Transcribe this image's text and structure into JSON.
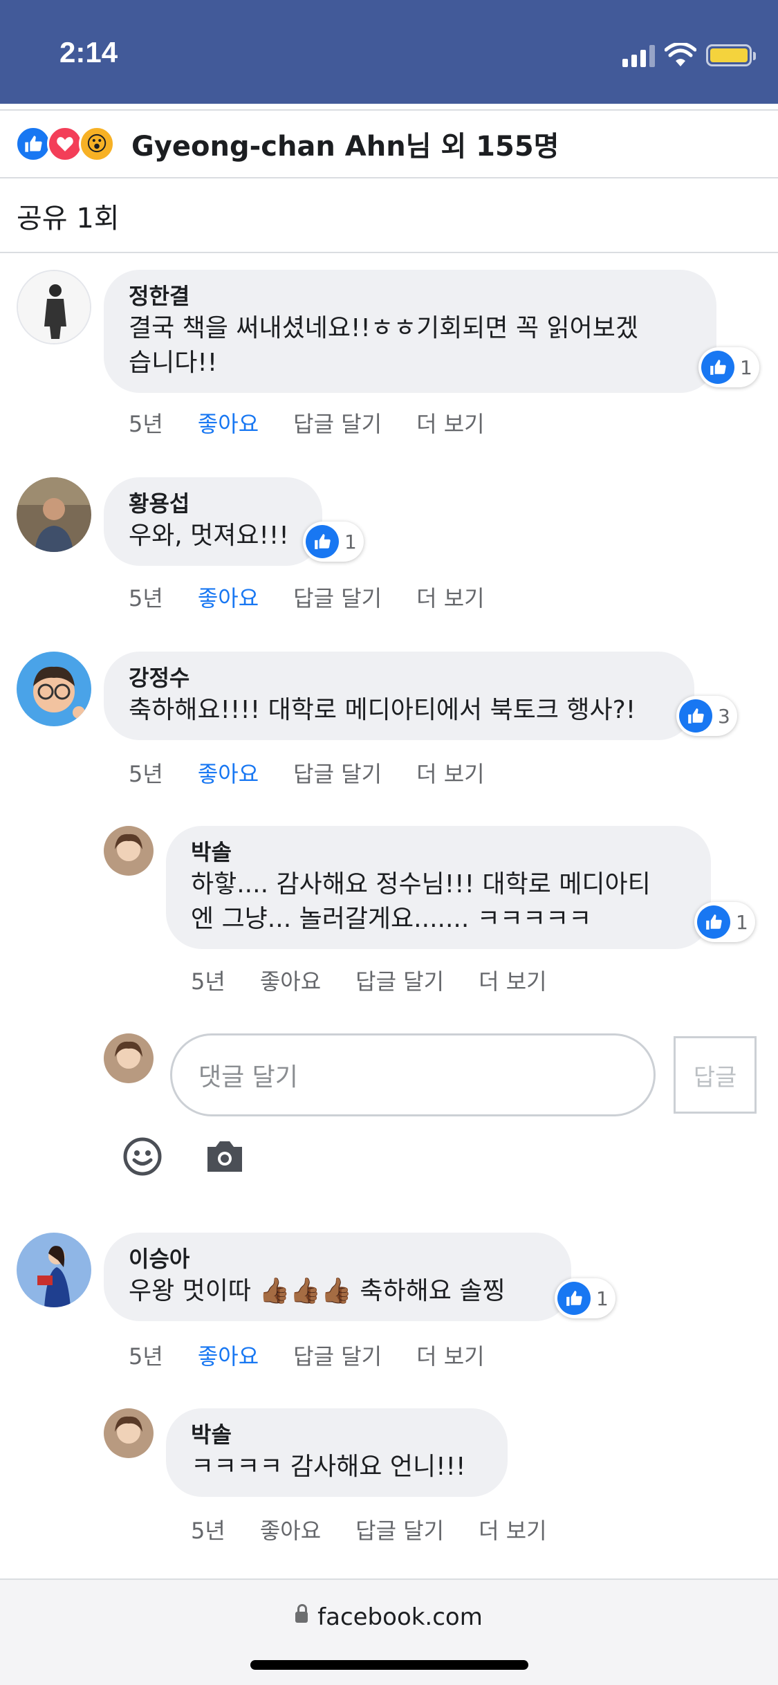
{
  "status_bar": {
    "time": "2:14"
  },
  "reactions": {
    "icons": [
      "like-icon",
      "love-icon",
      "wow-icon"
    ],
    "text": "Gyeong-chan Ahn님 외 155명"
  },
  "share": {
    "text": "공유 1회"
  },
  "action_labels": {
    "like": "좋아요",
    "reply": "답글 달기",
    "more": "더 보기"
  },
  "comments": [
    {
      "author": "정한결",
      "lines": [
        "결국 책을 써내셨네요!!ㅎㅎ기회되면 꼭 읽어보겠",
        "습니다!!"
      ],
      "reaction_count": "1",
      "time": "5년",
      "liked": true
    },
    {
      "author": "황용섭",
      "lines": [
        "우와, 멋져요!!!"
      ],
      "reaction_count": "1",
      "time": "5년",
      "liked": true
    },
    {
      "author": "강정수",
      "lines": [
        "축하해요!!!! 대학로 메디아티에서 북토크 행사?!"
      ],
      "reaction_count": "3",
      "time": "5년",
      "liked": true
    },
    {
      "author": "박솔",
      "lines": [
        "하핳.... 감사해요 정수님!!! 대학로 메디아티",
        "엔 그냥... 놀러갈게요....... ㅋㅋㅋㅋㅋ"
      ],
      "reaction_count": "1",
      "time": "5년",
      "liked": false
    },
    {
      "author": "이승아",
      "lines": [
        "우왕 멋이따 👍🏾👍🏾👍🏾 축하해요 솔찡"
      ],
      "reaction_count": "1",
      "time": "5년",
      "liked": true
    },
    {
      "author": "박솔",
      "lines": [
        "ㅋㅋㅋㅋ 감사해요 언니!!!"
      ],
      "reaction_count": "",
      "time": "5년",
      "liked": false
    }
  ],
  "reply_box": {
    "placeholder": "댓글 달기",
    "button": "답글"
  },
  "browser": {
    "url": "facebook.com"
  },
  "colors": {
    "header_bg": "#425a99",
    "like_blue": "#1877f2",
    "bubble_bg": "#eff0f3"
  }
}
